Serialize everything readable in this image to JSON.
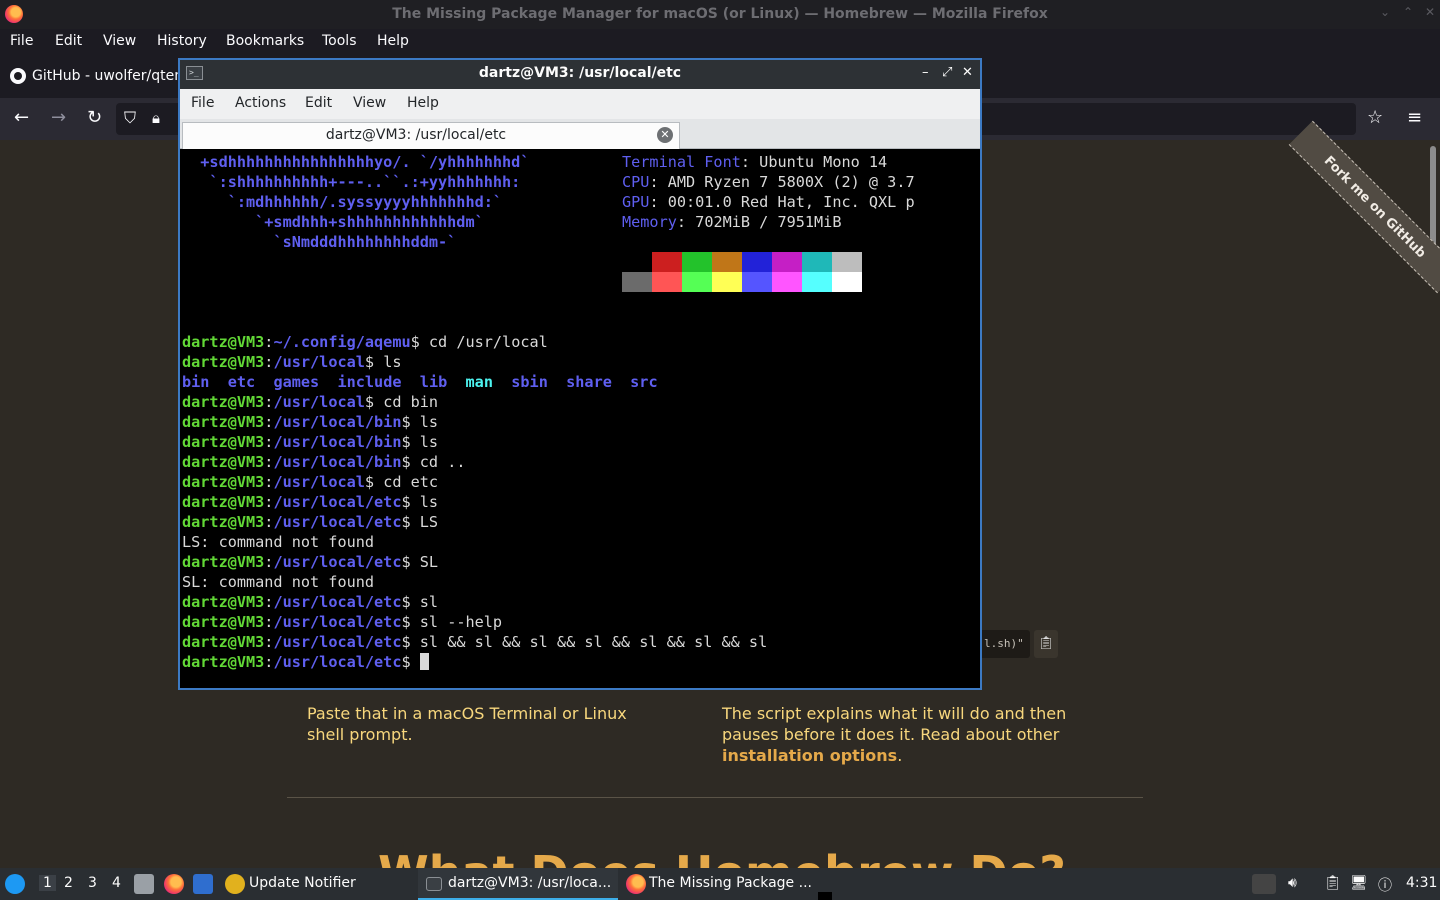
{
  "firefox": {
    "window_title": "The Missing Package Manager for macOS (or Linux) — Homebrew — Mozilla Firefox",
    "menu": [
      "File",
      "Edit",
      "View",
      "History",
      "Bookmarks",
      "Tools",
      "Help"
    ],
    "tab_label": "GitHub - uwolfer/qtem"
  },
  "page": {
    "fork_ribbon": "Fork me on GitHub",
    "code_tail": "l.sh)\"",
    "left_para": "Paste that in a macOS Terminal or Linux shell prompt.",
    "right_para_lead": "The script explains what it will do and then pauses before it does it. Read about other",
    "right_para_link": "installation options",
    "right_para_end": ".",
    "heading": "What Does Homebrew Do?"
  },
  "terminal": {
    "window_title": "dartz@VM3: /usr/local/etc",
    "menu": [
      "File",
      "Actions",
      "Edit",
      "View",
      "Help"
    ],
    "tab_label": "dartz@VM3: /usr/local/etc",
    "ascii_art": [
      "  +sdhhhhhhhhhhhhhhhhyo/. `/yhhhhhhhd`",
      "   `:shhhhhhhhhh+---..``.:+yyhhhhhhh:",
      "     `:mdhhhhhh/.syssyyyyhhhhhhhd:`",
      "        `+smdhhh+shhhhhhhhhhhhdm`",
      "          `sNmdddhhhhhhhhddm-`"
    ],
    "neofetch": [
      {
        "key": "Terminal Font",
        "value": "Ubuntu Mono 14"
      },
      {
        "key": "CPU",
        "value": "AMD Ryzen 7 5800X (2) @ 3.7"
      },
      {
        "key": "GPU",
        "value": "00:01.0 Red Hat, Inc. QXL p"
      },
      {
        "key": "Memory",
        "value": "702MiB / 7951MiB"
      }
    ],
    "palette_top": [
      "#000000",
      "#cc1f1f",
      "#23c22b",
      "#c07618",
      "#2222d8",
      "#c51fc5",
      "#1fb8b8",
      "#bdbdbd"
    ],
    "palette_bottom": [
      "#6b6b6b",
      "#ff5555",
      "#55ff55",
      "#ffff55",
      "#5555ff",
      "#ff55ff",
      "#55ffff",
      "#ffffff"
    ],
    "user_host": "dartz@VM3",
    "lines": [
      {
        "type": "prompt",
        "path": "~/.config/aqemu",
        "cmd": "cd /usr/local"
      },
      {
        "type": "prompt",
        "path": "/usr/local",
        "cmd": "ls"
      },
      {
        "type": "ls",
        "items": [
          "bin",
          "etc",
          "games",
          "include",
          "lib",
          "man",
          "sbin",
          "share",
          "src"
        ]
      },
      {
        "type": "prompt",
        "path": "/usr/local",
        "cmd": "cd bin"
      },
      {
        "type": "prompt",
        "path": "/usr/local/bin",
        "cmd": "ls"
      },
      {
        "type": "prompt",
        "path": "/usr/local/bin",
        "cmd": "ls"
      },
      {
        "type": "prompt",
        "path": "/usr/local/bin",
        "cmd": "cd .."
      },
      {
        "type": "prompt",
        "path": "/usr/local",
        "cmd": "cd etc"
      },
      {
        "type": "prompt",
        "path": "/usr/local/etc",
        "cmd": "ls"
      },
      {
        "type": "prompt",
        "path": "/usr/local/etc",
        "cmd": "LS"
      },
      {
        "type": "out",
        "text": "LS: command not found"
      },
      {
        "type": "prompt",
        "path": "/usr/local/etc",
        "cmd": "SL"
      },
      {
        "type": "out",
        "text": "SL: command not found"
      },
      {
        "type": "prompt",
        "path": "/usr/local/etc",
        "cmd": "sl"
      },
      {
        "type": "prompt",
        "path": "/usr/local/etc",
        "cmd": "sl --help"
      },
      {
        "type": "prompt",
        "path": "/usr/local/etc",
        "cmd": "sl && sl && sl && sl && sl && sl && sl"
      },
      {
        "type": "prompt",
        "path": "/usr/local/etc",
        "cmd": "",
        "cursor": true
      }
    ]
  },
  "taskbar": {
    "desktops": [
      "1",
      "2",
      "3",
      "4"
    ],
    "tasks": [
      "Update Notifier",
      "dartz@VM3: /usr/loca...",
      "The Missing Package ..."
    ],
    "clock": "4:31"
  }
}
